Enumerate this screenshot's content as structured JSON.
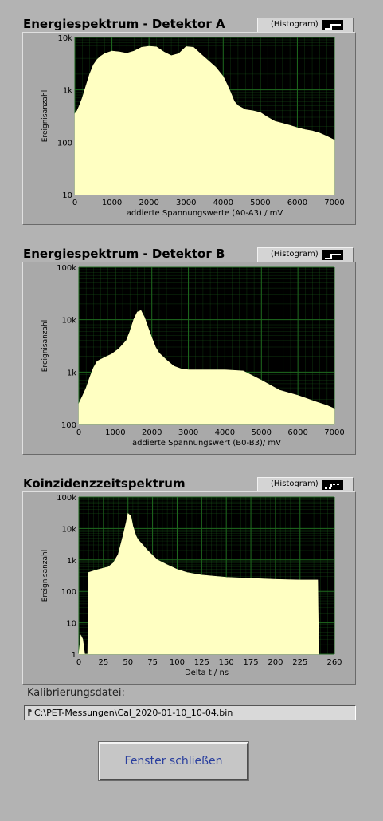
{
  "charts": [
    {
      "title": "Energiespektrum - Detektor A",
      "legend_label": "(Histogram)",
      "xlabel": "addierte Spannungswerte (A0-A3) / mV",
      "ylabel": "Ereignisanzahl"
    },
    {
      "title": "Energiespektrum - Detektor B",
      "legend_label": "(Histogram)",
      "xlabel": "addierte Spannungswert (B0-B3)/ mV",
      "ylabel": "Ereignisanzahl"
    },
    {
      "title": "Koinzidenzzeitspektrum",
      "legend_label": "(Histogram)",
      "xlabel": "Delta t / ns",
      "ylabel": "Ereignisanzahl"
    }
  ],
  "calibration": {
    "label": "Kalibrierungsdatei:",
    "path": "C:\\PET-Messungen\\Cal_2020-01-10_10-04.bin"
  },
  "close_button": {
    "label": "Fenster schließen"
  },
  "colors": {
    "plot_bg": "#000000",
    "grid": "#1f6b1f",
    "fill": "#ffffc2"
  },
  "chart_data": [
    {
      "type": "area",
      "title": "Energiespektrum - Detektor A",
      "xlabel": "addierte Spannungswerte (A0-A3) / mV",
      "ylabel": "Ereignisanzahl",
      "xlim": [
        0,
        7000
      ],
      "ylim": [
        10,
        10000
      ],
      "yscale": "log",
      "grid": true,
      "x_ticks": [
        "0",
        "1000",
        "2000",
        "3000",
        "4000",
        "5000",
        "6000",
        "7000"
      ],
      "y_ticks": [
        "10",
        "100",
        "1k",
        "10k"
      ],
      "x": [
        0,
        60,
        120,
        200,
        300,
        400,
        500,
        600,
        700,
        800,
        900,
        1000,
        1200,
        1400,
        1600,
        1800,
        2000,
        2200,
        2400,
        2600,
        2800,
        3000,
        3200,
        3400,
        3600,
        3800,
        4000,
        4100,
        4200,
        4300,
        4400,
        4600,
        4800,
        5000,
        5200,
        5400,
        5600,
        5800,
        6000,
        6200,
        6400,
        6600,
        6800,
        7000
      ],
      "values": [
        350,
        400,
        500,
        700,
        1200,
        2000,
        3000,
        3800,
        4400,
        4900,
        5200,
        5500,
        5300,
        5000,
        5500,
        6500,
        6800,
        6600,
        5300,
        4500,
        4900,
        6700,
        6500,
        4800,
        3600,
        2700,
        1800,
        1300,
        900,
        600,
        500,
        420,
        400,
        370,
        300,
        250,
        230,
        210,
        190,
        175,
        165,
        150,
        130,
        110
      ]
    },
    {
      "type": "area",
      "title": "Energiespektrum - Detektor B",
      "xlabel": "addierte Spannungswert (B0-B3)/ mV",
      "ylabel": "Ereignisanzahl",
      "xlim": [
        0,
        7000
      ],
      "ylim": [
        100,
        100000
      ],
      "yscale": "log",
      "grid": true,
      "x_ticks": [
        "0",
        "1000",
        "2000",
        "3000",
        "4000",
        "5000",
        "6000",
        "7000"
      ],
      "y_ticks": [
        "100",
        "1k",
        "10k",
        "100k"
      ],
      "x": [
        0,
        100,
        200,
        300,
        400,
        500,
        700,
        900,
        1100,
        1300,
        1400,
        1500,
        1600,
        1700,
        1800,
        1900,
        2000,
        2100,
        2200,
        2400,
        2600,
        2800,
        3000,
        3500,
        4000,
        4500,
        5000,
        5500,
        6000,
        6500,
        6800,
        7000
      ],
      "values": [
        250,
        350,
        500,
        800,
        1200,
        1600,
        1900,
        2200,
        2800,
        4000,
        6000,
        10000,
        14000,
        15000,
        11000,
        7000,
        4500,
        3000,
        2300,
        1700,
        1300,
        1150,
        1100,
        1100,
        1100,
        1050,
        700,
        450,
        360,
        270,
        230,
        200
      ]
    },
    {
      "type": "area",
      "title": "Koinzidenzzeitspektrum",
      "xlabel": "Delta t / ns",
      "ylabel": "Ereignisanzahl",
      "xlim": [
        0,
        260
      ],
      "ylim": [
        1,
        100000
      ],
      "yscale": "log",
      "grid": true,
      "x_ticks": [
        "0",
        "25",
        "50",
        "75",
        "100",
        "125",
        "150",
        "175",
        "200",
        "225",
        "260"
      ],
      "y_ticks": [
        "1",
        "10",
        "100",
        "1k",
        "10k",
        "100k"
      ],
      "x": [
        0,
        2,
        4,
        6,
        8,
        9,
        10,
        15,
        20,
        25,
        30,
        35,
        40,
        45,
        48,
        50,
        53,
        55,
        58,
        60,
        65,
        70,
        75,
        80,
        90,
        100,
        110,
        125,
        150,
        175,
        200,
        225,
        243,
        244
      ],
      "values": [
        1,
        4,
        3,
        1,
        1,
        1,
        400,
        450,
        500,
        550,
        600,
        800,
        1500,
        6000,
        15000,
        30000,
        25000,
        12000,
        6000,
        4500,
        3000,
        2000,
        1400,
        1000,
        700,
        500,
        400,
        330,
        280,
        260,
        240,
        230,
        230,
        1
      ]
    }
  ]
}
